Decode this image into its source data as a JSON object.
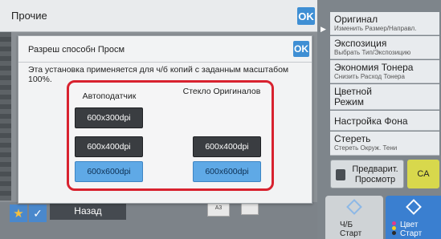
{
  "top_bar": {
    "title": "Прочие",
    "ok_label": "OK"
  },
  "dialog": {
    "title": "Разреш способн Просм",
    "ok_label": "OK",
    "description": "Эта установка применяется для ч/б копий с заданным масштабом 100%.",
    "columns": [
      {
        "header": "Автоподатчик"
      },
      {
        "header": "Стекло Оригиналов"
      }
    ],
    "adf_options": [
      {
        "label": "600x300dpi",
        "selected": false
      },
      {
        "label": "600x400dpi",
        "selected": false
      },
      {
        "label": "600x600dpi",
        "selected": true
      }
    ],
    "glass_options": [
      {
        "label": "600x400dpi",
        "selected": false
      },
      {
        "label": "600x600dpi",
        "selected": true
      }
    ]
  },
  "side_menu": {
    "items": [
      {
        "main": "Оригинал",
        "sub": "Изменить Размер/Направл."
      },
      {
        "main": "Экспозиция",
        "sub": "Выбрать Тип/Экспозицию"
      },
      {
        "main": "Экономия Тонера",
        "sub": "Снизить Расход Тонера"
      },
      {
        "main": "Цветной Режим",
        "sub": ""
      },
      {
        "main": "Настройка Фона",
        "sub": ""
      },
      {
        "main": "Стереть",
        "sub": "Стереть Окруж. Тени"
      }
    ],
    "preview_label": "Предварит. Просмотр",
    "ca_label": "CA",
    "start_bw_label": "Ч/Б Старт",
    "start_color_label": "Цвет Старт"
  },
  "bottom_bar": {
    "back_label": "Назад",
    "thumb_label": "A3"
  },
  "colors": {
    "accent_blue": "#3f8fd4",
    "frame_red": "#d8222f",
    "selected_blue": "#5fa9e6",
    "dark_button": "#3a3d41",
    "ca_yellow": "#d8d84c"
  }
}
